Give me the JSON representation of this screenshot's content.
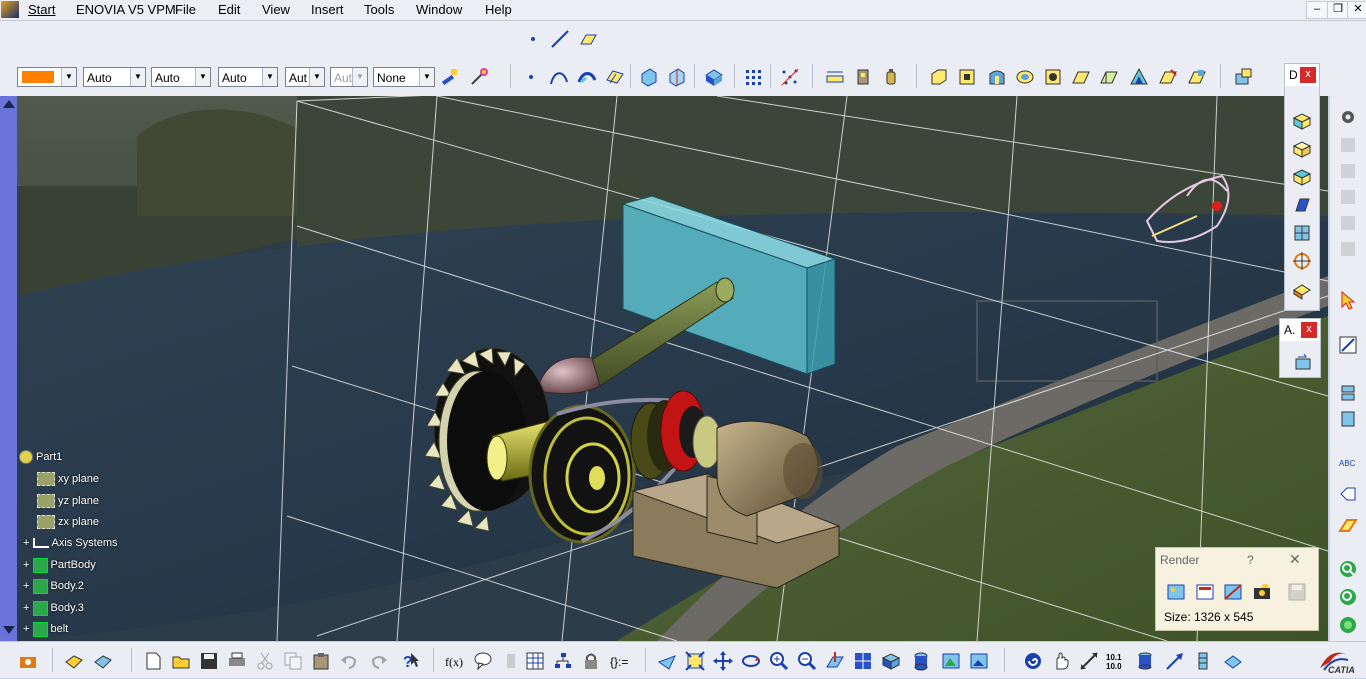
{
  "menubar": {
    "start": "Start",
    "app": "ENOVIA V5 VPM",
    "items": [
      "File",
      "Edit",
      "View",
      "Insert",
      "Tools",
      "Window",
      "Help"
    ],
    "minimize": "–",
    "restore": "❐",
    "close": "✕"
  },
  "graphic_props": {
    "fill_color": "#ff7f00",
    "line_type": "Auto",
    "line_thickness": "Auto",
    "point_symbol": "Auto",
    "layer": "Aut",
    "layer_disabled": "Aut",
    "render_style": "None"
  },
  "tree": {
    "root": "Part1",
    "items": [
      "xy plane",
      "yz plane",
      "zx plane",
      "Axis Systems",
      "PartBody",
      "Body.2",
      "Body.3",
      "belt"
    ]
  },
  "render_dialog": {
    "title": "Render",
    "help": "?",
    "close": "✕",
    "size_text": "Size: 1326 x 545"
  },
  "palettes": {
    "d_label": "D",
    "a_label": "A.",
    "close": "x"
  },
  "brand": "CATIA",
  "accent_colors": {
    "blue_strip": "#6a73d9",
    "gear": "#e8e6c0",
    "shaft": "#6b7a3e",
    "motor": "#a79575",
    "block": "#5fc8d6"
  }
}
